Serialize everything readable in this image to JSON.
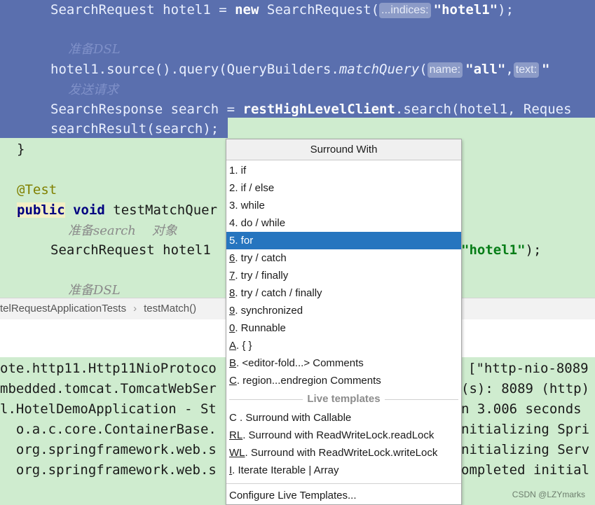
{
  "editor": {
    "lines": [
      {
        "code_pre": "SearchRequest hotel1 = ",
        "kw": "new",
        "code_mid": " SearchRequest(",
        "hint": "...indices:",
        "str": "\"hotel1\"",
        "code_post": ");"
      },
      {
        "comment": "准备DSL"
      },
      {
        "code_pre": "hotel1.source().query(QueryBuilders.",
        "italic": "matchQuery",
        "code_mid": "(",
        "hint1": "name:",
        "str1": "\"all\"",
        "sep": ",",
        "hint2": "text:",
        "str2": "\""
      },
      {
        "comment": "发送请求"
      },
      {
        "code_pre": "SearchResponse search = ",
        "bold": "restHighLevelClient",
        "code_post": ".search(hotel1, Reques"
      },
      {
        "code": "searchResult(search);"
      },
      {
        "code": "}"
      },
      {
        "annotation": "@Test"
      },
      {
        "kw1": "public",
        "kw2": "void",
        "code": " testMatchQuer"
      },
      {
        "comment_a": "准备search",
        "comment_b": "对象"
      },
      {
        "code": "SearchRequest hotel1",
        "str": "\"hotel1\"",
        "code_post": ");"
      },
      {
        "comment": "准备DSL"
      }
    ]
  },
  "breadcrumb": {
    "items": [
      "telRequestApplicationTests",
      "testMatch()"
    ],
    "separator": "›"
  },
  "console": {
    "lines": [
      {
        "left": "ote.http11.Http11NioProtoco",
        "right": "[\"http-nio-8089"
      },
      {
        "left": "mbedded.tomcat.TomcatWebSer",
        "right": "(s): 8089 (http)"
      },
      {
        "left": "l.HotelDemoApplication - St",
        "right": "n 3.006 seconds"
      },
      {
        "left": "  o.a.c.core.ContainerBase.",
        "right": "nitializing Spri"
      },
      {
        "left": "  org.springframework.web.s",
        "right": "nitializing Serv"
      },
      {
        "left": "  org.springframework.web.s",
        "right": "ompleted initial"
      }
    ]
  },
  "popup": {
    "title": "Surround With",
    "items": [
      {
        "mnemonic": "1",
        "text": ". if",
        "underline": false
      },
      {
        "mnemonic": "2",
        "text": ". if / else",
        "underline": false
      },
      {
        "mnemonic": "3",
        "text": ". while",
        "underline": false
      },
      {
        "mnemonic": "4",
        "text": ". do / while",
        "underline": false
      },
      {
        "mnemonic": "5",
        "text": ". for",
        "underline": false,
        "selected": true
      },
      {
        "mnemonic": "6",
        "text": ". try / catch",
        "underline": true
      },
      {
        "mnemonic": "7",
        "text": ". try / finally",
        "underline": true
      },
      {
        "mnemonic": "8",
        "text": ". try / catch / finally",
        "underline": true
      },
      {
        "mnemonic": "9",
        "text": ". synchronized",
        "underline": true
      },
      {
        "mnemonic": "0",
        "text": ". Runnable",
        "underline": true
      },
      {
        "mnemonic": "A",
        "text": ". { }",
        "underline": true
      },
      {
        "mnemonic": "B",
        "text": ". <editor-fold...> Comments",
        "underline": true
      },
      {
        "mnemonic": "C",
        "text": ". region...endregion Comments",
        "underline": true
      }
    ],
    "live_section": "Live templates",
    "live_items": [
      {
        "mnemonic": "C",
        "text": " . Surround with Callable",
        "underline": false
      },
      {
        "mnemonic": "RL",
        "text": ". Surround with ReadWriteLock.readLock",
        "underline": true
      },
      {
        "mnemonic": "WL",
        "text": ". Surround with ReadWriteLock.writeLock",
        "underline": true
      },
      {
        "mnemonic": "I",
        "text": ". Iterate Iterable | Array",
        "underline": true
      }
    ],
    "footer": "Configure Live Templates..."
  },
  "watermark": "CSDN @LZYmarks",
  "colors": {
    "selection": "#5a6fae",
    "editor_bg": "#cfeccf",
    "selected_item": "#2675bf"
  }
}
